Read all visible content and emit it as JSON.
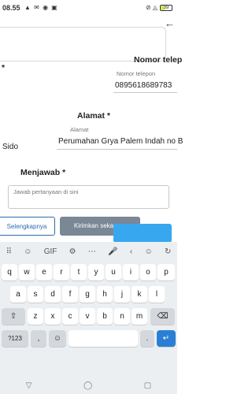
{
  "status_bar": {
    "time": "08.55",
    "left_icons": "▲ ✉ ◉ ▣",
    "right_icons": "⊘ ◬",
    "battery_level": 0.39,
    "battery_label": "39"
  },
  "form": {
    "back_icon": "arrow-left-icon",
    "phone": {
      "label": "Nomor telep",
      "sub_label": "Nomor telepon",
      "value": "0895618689783"
    },
    "address": {
      "label": "Alamat *",
      "sub_label": "Alamat",
      "value": "Perumahan Grya Palem Indah no B"
    },
    "left_asterisk": "*",
    "left_value": "Sido",
    "answer": {
      "label": "Menjawab *",
      "placeholder": "Jawab pertanyaan di sini"
    },
    "buttons": {
      "outline_label": "Selengkapnya",
      "grey_label": "Kirimkan sekarang",
      "blue_label": ""
    }
  },
  "keyboard": {
    "toolbar": [
      "⠿",
      "☺",
      "GIF",
      "⚙",
      "⋯",
      "🎤",
      "‹",
      "☺",
      "↻"
    ],
    "row1": [
      "q",
      "w",
      "e",
      "r",
      "t",
      "y",
      "u",
      "i",
      "o",
      "p"
    ],
    "row2": [
      "a",
      "s",
      "d",
      "f",
      "g",
      "h",
      "j",
      "k",
      "l"
    ],
    "row3": [
      "z",
      "x",
      "c",
      "v",
      "b",
      "n",
      "m"
    ],
    "shift": "⇧",
    "backspace": "⌫",
    "symbols": "?123",
    "comma": ",",
    "emoji": "☺",
    "space": "",
    "period": ".",
    "enter": "↵",
    "nav": [
      "▽",
      "◯",
      "▢"
    ]
  },
  "colors": {
    "accent": "#37a8f0",
    "primary": "#2b6cb0",
    "enter_key": "#2a7fd4"
  }
}
